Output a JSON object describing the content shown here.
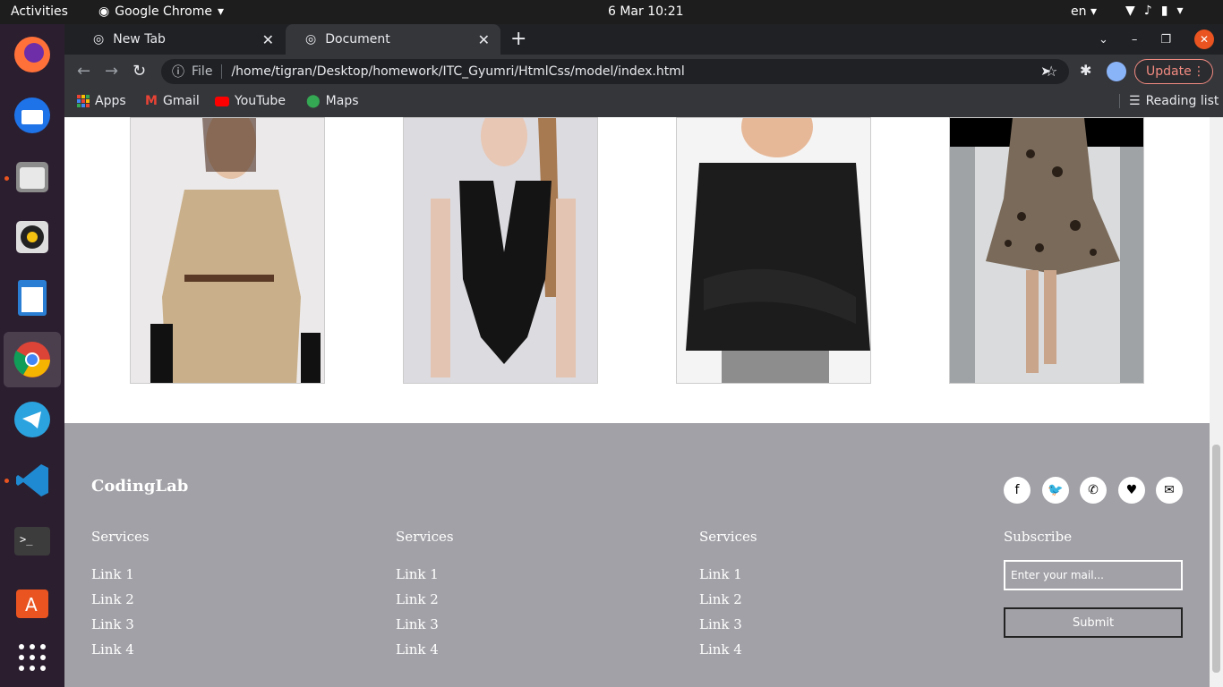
{
  "topbar": {
    "activities": "Activities",
    "app_name": "Google Chrome",
    "clock": "6 Mar  10:21",
    "lang": "en"
  },
  "dock": {
    "items": [
      "firefox-icon",
      "thunderbird-icon",
      "files-icon",
      "rhythmbox-icon",
      "writer-icon",
      "chrome-icon",
      "telegram-icon",
      "vscode-icon",
      "terminal-icon",
      "software-icon",
      "show-apps-icon"
    ]
  },
  "tabs": [
    {
      "title": "New Tab",
      "active": false
    },
    {
      "title": "Document",
      "active": true
    }
  ],
  "toolbar": {
    "scheme": "File",
    "url": "/home/tigran/Desktop/homework/ITC_Gyumri/HtmlCss/model/index.html",
    "update_label": "Update"
  },
  "bookmarks": {
    "apps": "Apps",
    "gmail": "Gmail",
    "youtube": "YouTube",
    "maps": "Maps",
    "reading_list": "Reading list"
  },
  "footer": {
    "brand": "CodingLab",
    "columns": [
      {
        "heading": "Services",
        "links": [
          "Link 1",
          "Link 2",
          "Link 3",
          "Link 4"
        ]
      },
      {
        "heading": "Services",
        "links": [
          "Link 1",
          "Link 2",
          "Link 3",
          "Link 4"
        ]
      },
      {
        "heading": "Services",
        "links": [
          "Link 1",
          "Link 2",
          "Link 3",
          "Link 4"
        ]
      }
    ],
    "subscribe": {
      "heading": "Subscribe",
      "placeholder": "Enter your mail...",
      "button": "Submit"
    },
    "social": [
      "facebook-icon",
      "twitter-icon",
      "phone-icon",
      "heart-icon",
      "mail-icon"
    ]
  },
  "colors": {
    "footer_bg": "#a2a1a7",
    "tab_bar": "#202124",
    "toolbar": "#35363a",
    "dock": "#2b1e2f",
    "accent": "#e95420"
  }
}
